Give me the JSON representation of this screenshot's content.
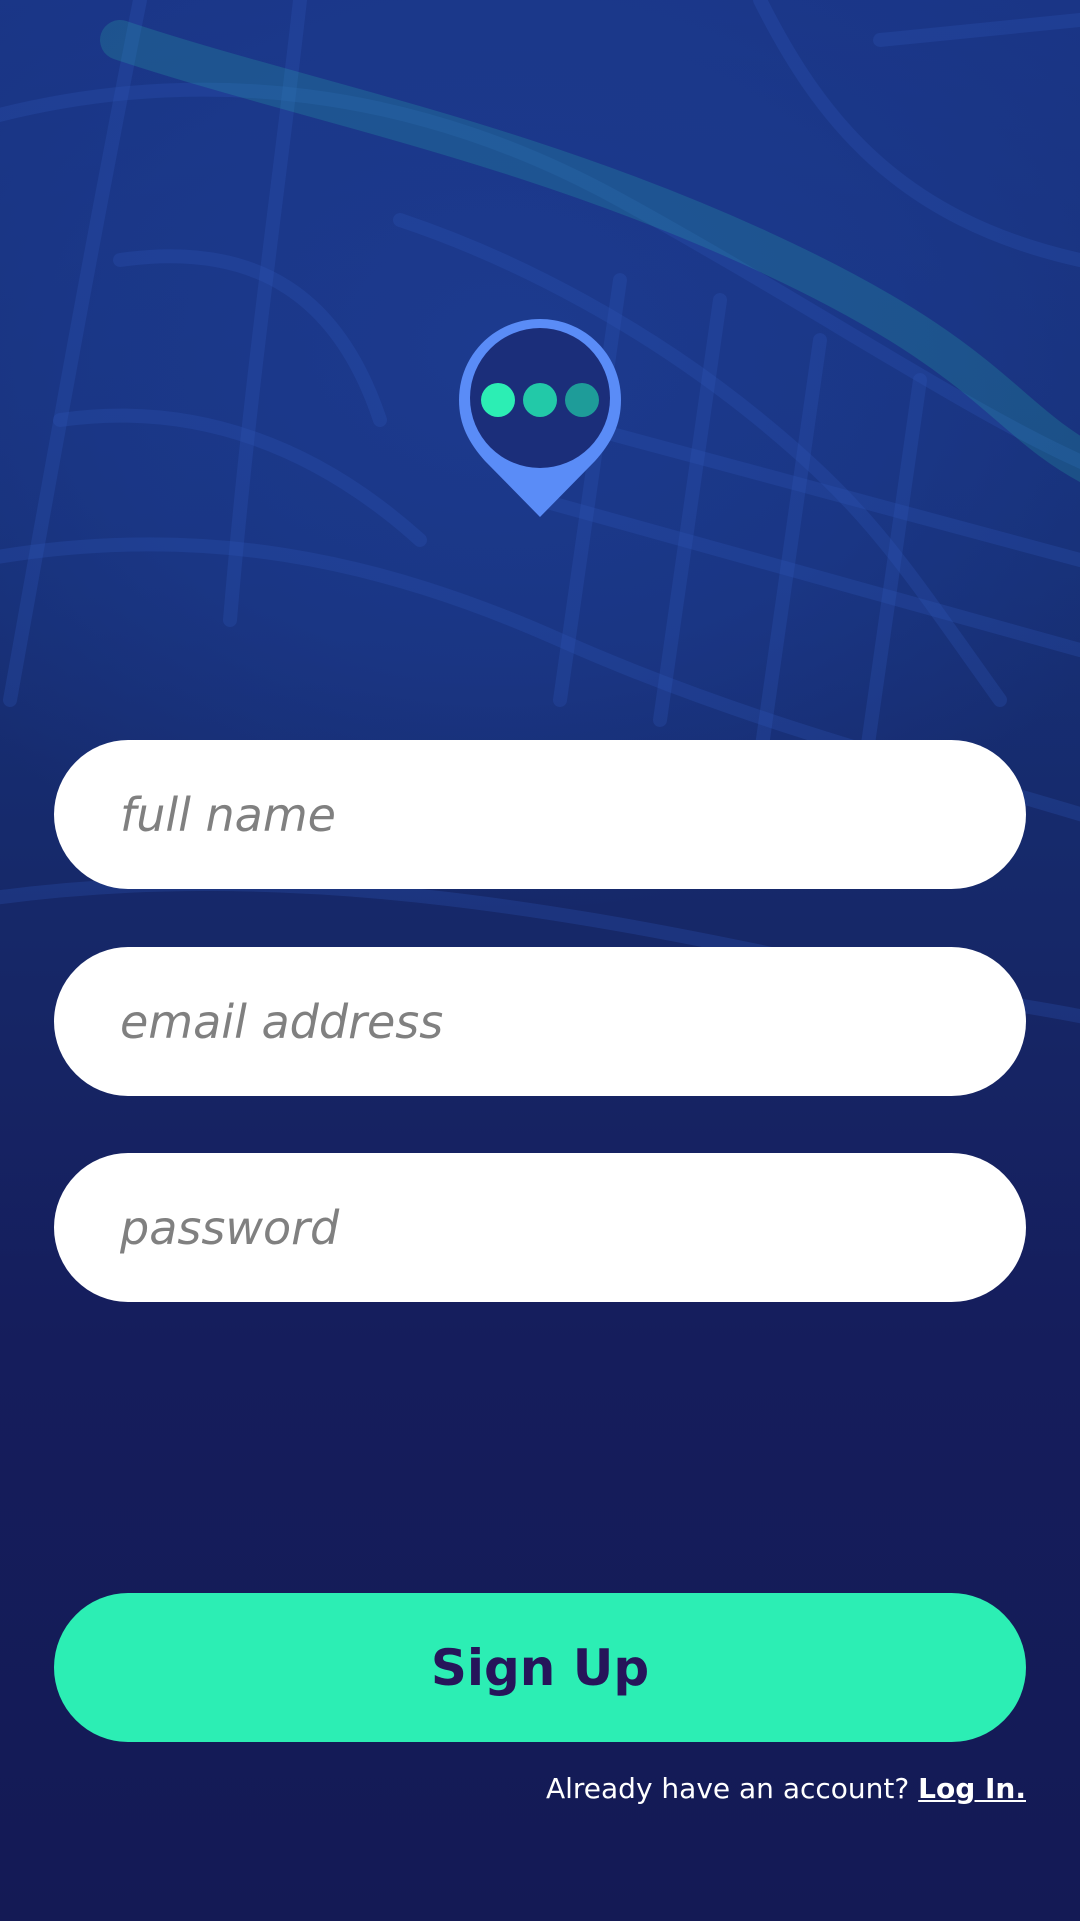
{
  "colors": {
    "background": "#15185a",
    "map_lines": "#2c4fb0",
    "logo_blue": "#5a8cf7",
    "dot_1": "#2ceeb4",
    "dot_2": "#22c9a8",
    "dot_3": "#1e9c99",
    "button": "#2ceeb4",
    "button_text": "#26155a",
    "field": "#ffffff",
    "placeholder": "#808080"
  },
  "logo": {
    "icon": "location-pin-chat-icon"
  },
  "form": {
    "full_name": {
      "placeholder": "full name",
      "value": ""
    },
    "email": {
      "placeholder": "email address",
      "value": ""
    },
    "password": {
      "placeholder": "password",
      "value": ""
    }
  },
  "signup_button": {
    "label": "Sign Up"
  },
  "footer": {
    "prompt": "Already have an account? ",
    "login_link": "Log In."
  }
}
